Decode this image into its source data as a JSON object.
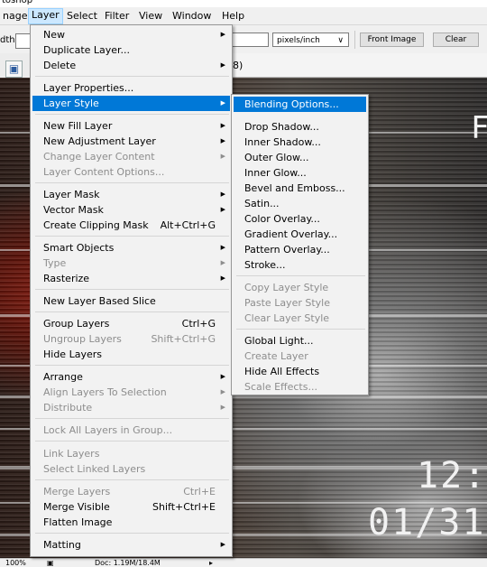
{
  "window": {
    "title_fragment": "toshop"
  },
  "menubar": {
    "items": [
      {
        "label": "nage"
      },
      {
        "label": "Layer"
      },
      {
        "label": "Select"
      },
      {
        "label": "Filter"
      },
      {
        "label": "View"
      },
      {
        "label": "Window"
      },
      {
        "label": "Help"
      }
    ]
  },
  "options_bar": {
    "width_label": "dth:",
    "resolution_unit": "pixels/inch",
    "front_image_button": "Front Image",
    "clear_button": "Clear"
  },
  "document": {
    "tab_title_fragment": "8)"
  },
  "canvas": {
    "text_fragment_1": "12:",
    "text_fragment_2": "01/31",
    "text_fragment_3": "F"
  },
  "status_bar": {
    "zoom": "100%",
    "doc_size": "Doc: 1.19M/18.4M"
  },
  "layer_menu": {
    "items": [
      {
        "label": "New",
        "shortcut": "",
        "arrow": true,
        "enabled": true
      },
      {
        "label": "Duplicate Layer...",
        "shortcut": "",
        "arrow": false,
        "enabled": true
      },
      {
        "label": "Delete",
        "shortcut": "",
        "arrow": true,
        "enabled": true
      },
      {
        "label": "Layer Properties...",
        "shortcut": "",
        "arrow": false,
        "enabled": true
      },
      {
        "label": "Layer Style",
        "shortcut": "",
        "arrow": true,
        "enabled": true
      },
      {
        "label": "New Fill Layer",
        "shortcut": "",
        "arrow": true,
        "enabled": true
      },
      {
        "label": "New Adjustment Layer",
        "shortcut": "",
        "arrow": true,
        "enabled": true
      },
      {
        "label": "Change Layer Content",
        "shortcut": "",
        "arrow": true,
        "enabled": false
      },
      {
        "label": "Layer Content Options...",
        "shortcut": "",
        "arrow": false,
        "enabled": false
      },
      {
        "label": "Layer Mask",
        "shortcut": "",
        "arrow": true,
        "enabled": true
      },
      {
        "label": "Vector Mask",
        "shortcut": "",
        "arrow": true,
        "enabled": true
      },
      {
        "label": "Create Clipping Mask",
        "shortcut": "Alt+Ctrl+G",
        "arrow": false,
        "enabled": true
      },
      {
        "label": "Smart Objects",
        "shortcut": "",
        "arrow": true,
        "enabled": true
      },
      {
        "label": "Type",
        "shortcut": "",
        "arrow": true,
        "enabled": false
      },
      {
        "label": "Rasterize",
        "shortcut": "",
        "arrow": true,
        "enabled": true
      },
      {
        "label": "New Layer Based Slice",
        "shortcut": "",
        "arrow": false,
        "enabled": true
      },
      {
        "label": "Group Layers",
        "shortcut": "Ctrl+G",
        "arrow": false,
        "enabled": true
      },
      {
        "label": "Ungroup Layers",
        "shortcut": "Shift+Ctrl+G",
        "arrow": false,
        "enabled": false
      },
      {
        "label": "Hide Layers",
        "shortcut": "",
        "arrow": false,
        "enabled": true
      },
      {
        "label": "Arrange",
        "shortcut": "",
        "arrow": true,
        "enabled": true
      },
      {
        "label": "Align Layers To Selection",
        "shortcut": "",
        "arrow": true,
        "enabled": false
      },
      {
        "label": "Distribute",
        "shortcut": "",
        "arrow": true,
        "enabled": false
      },
      {
        "label": "Lock All Layers in Group...",
        "shortcut": "",
        "arrow": false,
        "enabled": false
      },
      {
        "label": "Link Layers",
        "shortcut": "",
        "arrow": false,
        "enabled": false
      },
      {
        "label": "Select Linked Layers",
        "shortcut": "",
        "arrow": false,
        "enabled": false
      },
      {
        "label": "Merge Layers",
        "shortcut": "Ctrl+E",
        "arrow": false,
        "enabled": false
      },
      {
        "label": "Merge Visible",
        "shortcut": "Shift+Ctrl+E",
        "arrow": false,
        "enabled": true
      },
      {
        "label": "Flatten Image",
        "shortcut": "",
        "arrow": false,
        "enabled": true
      },
      {
        "label": "Matting",
        "shortcut": "",
        "arrow": true,
        "enabled": true
      }
    ]
  },
  "layer_style_submenu": {
    "items": [
      {
        "label": "Blending Options...",
        "enabled": true
      },
      {
        "label": "Drop Shadow...",
        "enabled": true
      },
      {
        "label": "Inner Shadow...",
        "enabled": true
      },
      {
        "label": "Outer Glow...",
        "enabled": true
      },
      {
        "label": "Inner Glow...",
        "enabled": true
      },
      {
        "label": "Bevel and Emboss...",
        "enabled": true
      },
      {
        "label": "Satin...",
        "enabled": true
      },
      {
        "label": "Color Overlay...",
        "enabled": true
      },
      {
        "label": "Gradient Overlay...",
        "enabled": true
      },
      {
        "label": "Pattern Overlay...",
        "enabled": true
      },
      {
        "label": "Stroke...",
        "enabled": true
      },
      {
        "label": "Copy Layer Style",
        "enabled": false
      },
      {
        "label": "Paste Layer Style",
        "enabled": false
      },
      {
        "label": "Clear Layer Style",
        "enabled": false
      },
      {
        "label": "Global Light...",
        "enabled": true
      },
      {
        "label": "Create Layer",
        "enabled": false
      },
      {
        "label": "Hide All Effects",
        "enabled": true
      },
      {
        "label": "Scale Effects...",
        "enabled": false
      }
    ]
  },
  "colors": {
    "highlight": "#0078d7",
    "disabled_text": "#8d8d8d",
    "menu_bg": "#f2f2f2"
  }
}
